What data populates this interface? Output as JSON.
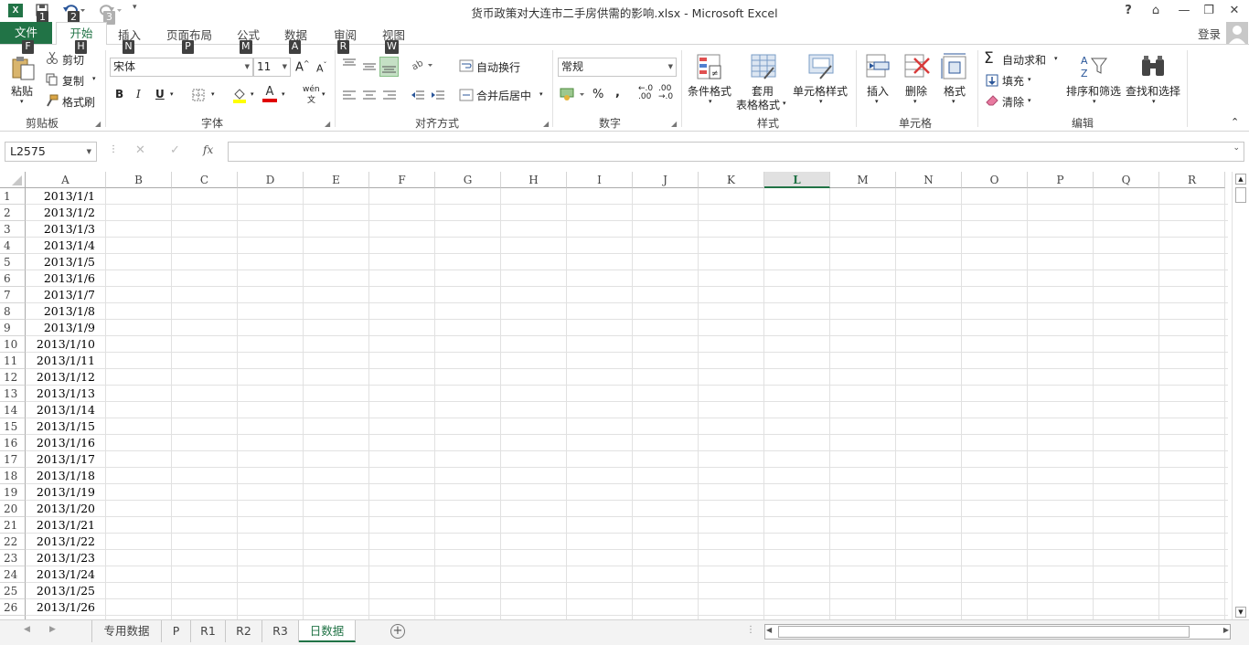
{
  "window": {
    "title": "货币政策对大连市二手房供需的影响.xlsx - Microsoft Excel",
    "help": "?",
    "ribbon_display": "⌂",
    "minimize": "—",
    "restore": "❐",
    "close": "✕",
    "signin": "登录"
  },
  "qat_keytips": [
    "1",
    "2",
    "3"
  ],
  "tabs": {
    "file": "文件",
    "home": "开始",
    "insert": "插入",
    "layout": "页面布局",
    "formulas": "公式",
    "data": "数据",
    "review": "审阅",
    "view": "视图"
  },
  "tab_keytips": {
    "file": "F",
    "home": "H",
    "insert": "N",
    "layout": "P",
    "formulas": "M",
    "data": "A",
    "review": "R",
    "view": "W"
  },
  "ribbon": {
    "clipboard": {
      "label": "剪贴板",
      "paste": "粘贴",
      "cut": "剪切",
      "copy": "复制",
      "format_painter": "格式刷"
    },
    "font": {
      "label": "字体",
      "font_name": "宋体",
      "font_size": "11",
      "bold": "B",
      "italic": "I",
      "underline": "U",
      "grow": "A",
      "shrink": "A",
      "font_color": "A",
      "phonetic": "wén"
    },
    "alignment": {
      "label": "对齐方式",
      "wrap": "自动换行",
      "merge": "合并后居中"
    },
    "number": {
      "label": "数字",
      "format": "常规",
      "percent": "%",
      "comma": ",",
      "inc_dec": ".00",
      "dec_dec": ".0"
    },
    "styles": {
      "label": "样式",
      "conditional": "条件格式",
      "table_1": "套用",
      "table_2": "表格格式",
      "cell_styles": "单元格样式"
    },
    "cells": {
      "label": "单元格",
      "insert": "插入",
      "delete": "删除",
      "format": "格式"
    },
    "editing": {
      "label": "编辑",
      "autosum": "自动求和",
      "fill": "填充",
      "clear": "清除",
      "sort": "排序和筛选",
      "find": "查找和选择"
    }
  },
  "formula_bar": {
    "name_box": "L2575",
    "fx": "fx",
    "cancel": "✕",
    "enter": "✓",
    "value": ""
  },
  "columns": [
    "A",
    "B",
    "C",
    "D",
    "E",
    "F",
    "G",
    "H",
    "I",
    "J",
    "K",
    "L",
    "M",
    "N",
    "O",
    "P",
    "Q",
    "R"
  ],
  "selected_column": "L",
  "rows": [
    {
      "n": "1",
      "a": "2013/1/1"
    },
    {
      "n": "2",
      "a": "2013/1/2"
    },
    {
      "n": "3",
      "a": "2013/1/3"
    },
    {
      "n": "4",
      "a": "2013/1/4"
    },
    {
      "n": "5",
      "a": "2013/1/5"
    },
    {
      "n": "6",
      "a": "2013/1/6"
    },
    {
      "n": "7",
      "a": "2013/1/7"
    },
    {
      "n": "8",
      "a": "2013/1/8"
    },
    {
      "n": "9",
      "a": "2013/1/9"
    },
    {
      "n": "10",
      "a": "2013/1/10"
    },
    {
      "n": "11",
      "a": "2013/1/11"
    },
    {
      "n": "12",
      "a": "2013/1/12"
    },
    {
      "n": "13",
      "a": "2013/1/13"
    },
    {
      "n": "14",
      "a": "2013/1/14"
    },
    {
      "n": "15",
      "a": "2013/1/15"
    },
    {
      "n": "16",
      "a": "2013/1/16"
    },
    {
      "n": "17",
      "a": "2013/1/17"
    },
    {
      "n": "18",
      "a": "2013/1/18"
    },
    {
      "n": "19",
      "a": "2013/1/19"
    },
    {
      "n": "20",
      "a": "2013/1/20"
    },
    {
      "n": "21",
      "a": "2013/1/21"
    },
    {
      "n": "22",
      "a": "2013/1/22"
    },
    {
      "n": "23",
      "a": "2013/1/23"
    },
    {
      "n": "24",
      "a": "2013/1/24"
    },
    {
      "n": "25",
      "a": "2013/1/25"
    },
    {
      "n": "26",
      "a": "2013/1/26"
    }
  ],
  "sheets": [
    "专用数据",
    "P",
    "R1",
    "R2",
    "R3",
    "日数据"
  ],
  "active_sheet": "日数据",
  "colors": {
    "accent": "#217346",
    "keytip": "#404040"
  }
}
